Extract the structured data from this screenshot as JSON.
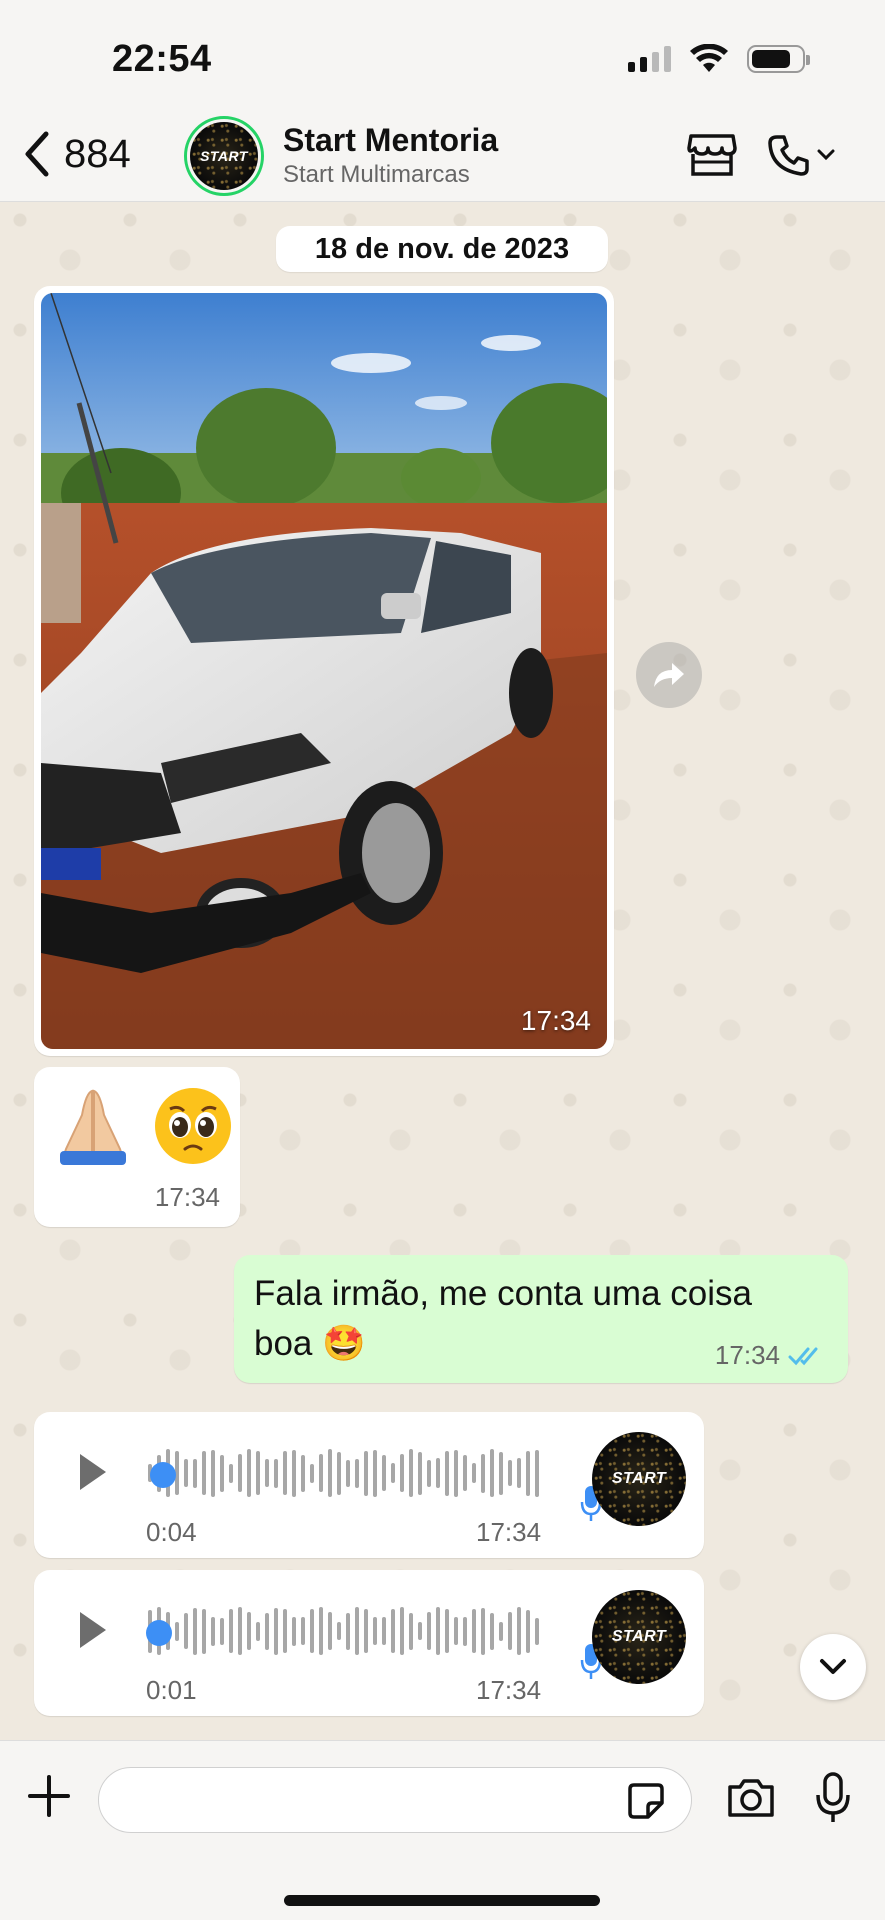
{
  "status_bar": {
    "time": "22:54"
  },
  "header": {
    "back_count": "884",
    "title": "Start Mentoria",
    "subtitle": "Start Multimarcas",
    "avatar_text": "START"
  },
  "date_divider": "18 de nov. de 2023",
  "messages": [
    {
      "type": "image",
      "direction": "incoming",
      "time": "17:34"
    },
    {
      "type": "emoji",
      "direction": "incoming",
      "emojis": [
        "folded-hands",
        "pleading-face"
      ],
      "time": "17:34"
    },
    {
      "type": "text",
      "direction": "outgoing",
      "text": "Fala irmão, me conta uma coisa boa 🤩",
      "time": "17:34",
      "status": "read"
    },
    {
      "type": "voice",
      "direction": "incoming",
      "duration": "0:04",
      "time": "17:34",
      "avatar_text": "START"
    },
    {
      "type": "voice",
      "direction": "incoming",
      "duration": "0:01",
      "time": "17:34",
      "avatar_text": "START"
    }
  ],
  "composer": {
    "placeholder": "",
    "value": ""
  },
  "colors": {
    "outgoing_bubble": "#d9fdd3",
    "incoming_bubble": "#ffffff",
    "read_ticks": "#53bdeb",
    "voice_dot": "#3d8ff5",
    "story_ring": "#25d366"
  }
}
